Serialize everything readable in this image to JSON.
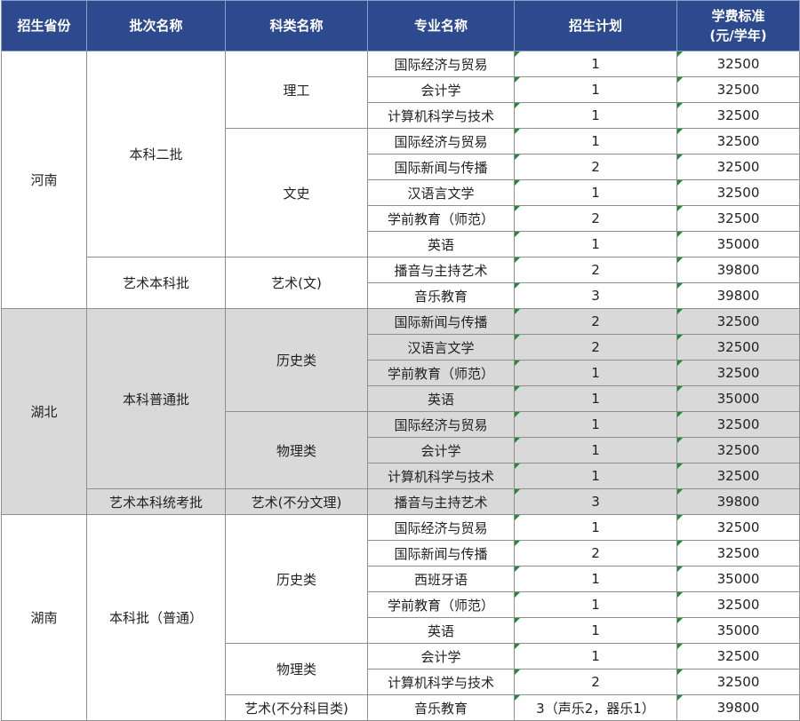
{
  "headers": {
    "province": "招生省份",
    "batch": "批次名称",
    "category": "科类名称",
    "major": "专业名称",
    "plan": "招生计划",
    "fee_line1": "学费标准",
    "fee_line2": "(元/学年)"
  },
  "provinces": {
    "henan": "河南",
    "hubei": "湖北",
    "hunan": "湖南"
  },
  "batches": {
    "henan_1": "本科二批",
    "henan_2": "艺术本科批",
    "hubei_1": "本科普通批",
    "hubei_2": "艺术本科统考批",
    "hunan_1": "本科批（普通）"
  },
  "categories": {
    "henan_1": "理工",
    "henan_2": "文史",
    "henan_3": "艺术(文)",
    "hubei_1": "历史类",
    "hubei_2": "物理类",
    "hubei_3": "艺术(不分文理)",
    "hunan_1": "历史类",
    "hunan_2": "物理类",
    "hunan_3": "艺术(不分科目类)"
  },
  "rows": [
    {
      "major": "国际经济与贸易",
      "plan": "1",
      "fee": "32500"
    },
    {
      "major": "会计学",
      "plan": "1",
      "fee": "32500"
    },
    {
      "major": "计算机科学与技术",
      "plan": "1",
      "fee": "32500"
    },
    {
      "major": "国际经济与贸易",
      "plan": "1",
      "fee": "32500"
    },
    {
      "major": "国际新闻与传播",
      "plan": "2",
      "fee": "32500"
    },
    {
      "major": "汉语言文学",
      "plan": "1",
      "fee": "32500"
    },
    {
      "major": "学前教育（师范）",
      "plan": "2",
      "fee": "32500"
    },
    {
      "major": "英语",
      "plan": "1",
      "fee": "35000"
    },
    {
      "major": "播音与主持艺术",
      "plan": "2",
      "fee": "39800"
    },
    {
      "major": "音乐教育",
      "plan": "3",
      "fee": "39800"
    },
    {
      "major": "国际新闻与传播",
      "plan": "2",
      "fee": "32500"
    },
    {
      "major": "汉语言文学",
      "plan": "2",
      "fee": "32500"
    },
    {
      "major": "学前教育（师范）",
      "plan": "1",
      "fee": "32500"
    },
    {
      "major": "英语",
      "plan": "1",
      "fee": "35000"
    },
    {
      "major": "国际经济与贸易",
      "plan": "1",
      "fee": "32500"
    },
    {
      "major": "会计学",
      "plan": "1",
      "fee": "32500"
    },
    {
      "major": "计算机科学与技术",
      "plan": "1",
      "fee": "32500"
    },
    {
      "major": "播音与主持艺术",
      "plan": "3",
      "fee": "39800"
    },
    {
      "major": "国际经济与贸易",
      "plan": "1",
      "fee": "32500"
    },
    {
      "major": "国际新闻与传播",
      "plan": "2",
      "fee": "32500"
    },
    {
      "major": "西班牙语",
      "plan": "1",
      "fee": "35000"
    },
    {
      "major": "学前教育（师范）",
      "plan": "1",
      "fee": "32500"
    },
    {
      "major": "英语",
      "plan": "1",
      "fee": "35000"
    },
    {
      "major": "会计学",
      "plan": "1",
      "fee": "32500"
    },
    {
      "major": "计算机科学与技术",
      "plan": "2",
      "fee": "32500"
    },
    {
      "major": "音乐教育",
      "plan": "3（声乐2，器乐1）",
      "fee": "39800"
    }
  ],
  "colors": {
    "header_bg": "#2d4a8f",
    "hubei_row_bg": "#d9d9d9",
    "cell_marker": "#1e8a3a"
  }
}
